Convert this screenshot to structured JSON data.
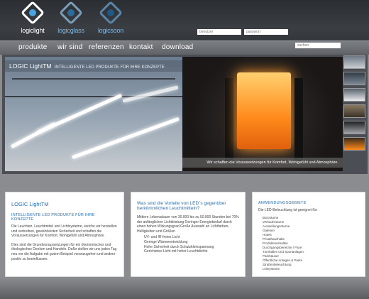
{
  "header": {
    "logos": [
      "logiclight",
      "logicglass",
      "logicsoon"
    ],
    "login_user_placeholder": "benutzer",
    "login_pass_placeholder": "passwort"
  },
  "nav": {
    "items": [
      "produkte",
      "wir sind",
      "referenzen",
      "kontakt",
      "download"
    ],
    "search_placeholder": "suchen"
  },
  "banner": {
    "brand": "LOGIC LightTM",
    "tagline": "INTELLIGENTE LED PRODUKTE FÜR IHRE KONZEPTE",
    "caption": "Wir schaffen die Voraussetzungen für Komfort, Wohlgefühl und Atmosphäre."
  },
  "box1": {
    "title": "LOGIC LightTM",
    "subtitle": "INTELLIGENTE LED PRODUKTE FÜR IHRE KONZEPTE",
    "paragraph1": "Die Leuchten, Leuchtmittel und Lichtsysteme, welche wir herstellen und vertreiben, gewährleisten Sicherheit und schaffen die Voraussetzungen für Komfort, Wohlgefühl und Atmosphäre.",
    "paragraph2": "Dies sind die Grundvoraussetzungen für ein ökonomisches und ökologisches Denken und Handeln. Dafür stellen wir uns jeden Tag neu vor die Aufgabe mit gutem Beispiel voranzugehen und andere positiv zu beeinflussen."
  },
  "box2": {
    "title": "Was sind die Vorteile von LED´s gegenüber herkömmlichen Leuchtmitteln?",
    "paragraph": "Mittlere Lebensdauer von 30.000 bis zu 50.000 Stunden bei 70% der anfänglichen Lichtleistung Geringer Energiebedarf durch einen hohen Wirkungsgrad Große Auswahl an Lichtfarben, Helligkeiten und Größen",
    "items": [
      "UV- und IR-freies Licht",
      "Geringe Wärmeentwicklung",
      "Hohe Sicherheit durch Schutzkleinspannung",
      "Gerichtetes Licht mit hoher Leuchtdichte"
    ]
  },
  "box3": {
    "title": "ANWENDUNGSGEBIETE",
    "intro": "Die LED-Beleuchtung ist geeignet für:",
    "items": [
      "Büroräume",
      "Verkaufsräume",
      "Ausstellungsräume",
      "Galerien",
      "Hotels",
      "Privathaushalte",
      "Produktionshallen",
      "Durchgangsbereiche / Flure",
      "Turnhallen und Sportanlagen",
      "Parkhäuser",
      "Öffentliche Anlagen & Parks",
      "Straßenbeleuchtung",
      "Leitsysteme"
    ]
  },
  "colors": {
    "heading_blue": "#2a6db0",
    "header_dark": "#2a2d31",
    "accent_orange": "#ff8a1a"
  }
}
